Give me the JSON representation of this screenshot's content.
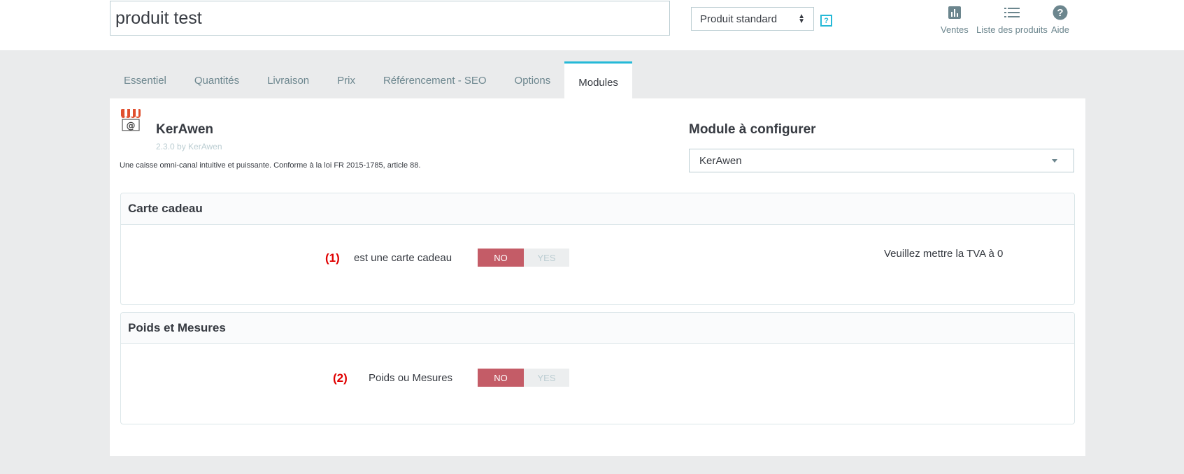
{
  "header": {
    "product_name": "produit test",
    "product_type": "Produit standard",
    "help_mark": "?",
    "toolbar": [
      {
        "label": "Ventes",
        "icon": "bar-chart-icon"
      },
      {
        "label": "Liste des produits",
        "icon": "list-icon"
      },
      {
        "label": "Aide",
        "icon": "help-circle-icon"
      }
    ]
  },
  "tabs": [
    {
      "label": "Essentiel",
      "active": false
    },
    {
      "label": "Quantités",
      "active": false
    },
    {
      "label": "Livraison",
      "active": false
    },
    {
      "label": "Prix",
      "active": false
    },
    {
      "label": "Référencement - SEO",
      "active": false
    },
    {
      "label": "Options",
      "active": false
    },
    {
      "label": "Modules",
      "active": true
    }
  ],
  "module": {
    "name": "KerAwen",
    "version": "2.3.0 by KerAwen",
    "description": "Une caisse omni-canal intuitive et puissante. Conforme à la loi FR 2015-1785, article 88.",
    "logo_icon": "shop-at-icon"
  },
  "configure": {
    "title": "Module à configurer",
    "selected": "KerAwen"
  },
  "cards": [
    {
      "title": "Carte cadeau",
      "marker": "(1)",
      "field_label": "est une carte cadeau",
      "no_label": "NO",
      "yes_label": "YES",
      "value": "NO",
      "note": "Veuillez mettre la TVA à 0"
    },
    {
      "title": "Poids et Mesures",
      "marker": "(2)",
      "field_label": "Poids ou Mesures",
      "no_label": "NO",
      "yes_label": "YES",
      "value": "NO"
    }
  ],
  "colors": {
    "accent": "#25b9d7",
    "switch_no": "#c45c67",
    "marker_red": "#e00000",
    "background": "#eaebec"
  }
}
